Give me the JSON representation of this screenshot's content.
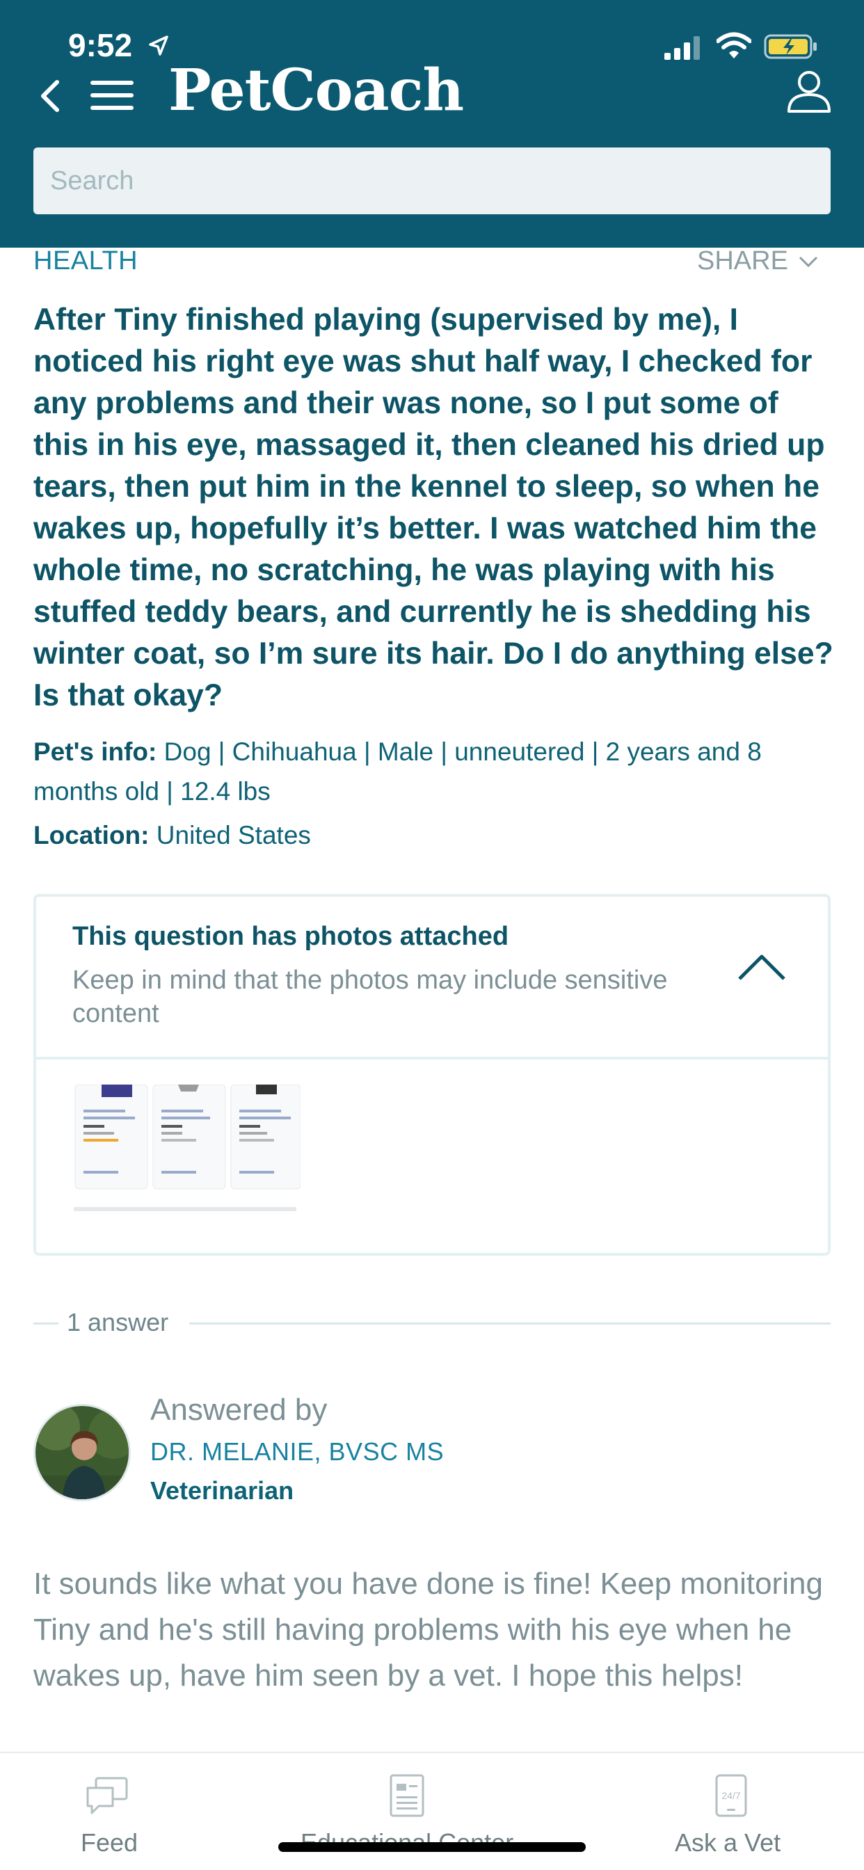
{
  "status_bar": {
    "time": "9:52"
  },
  "app": {
    "logo": "PetCoach",
    "search_placeholder": "Search"
  },
  "question": {
    "category": "HEALTH",
    "share_label": "SHARE",
    "text": "After Tiny finished playing (supervised by me), I noticed his right eye was shut half way, I checked for any problems and their was none, so I put some of this in his eye, massaged it, then cleaned his dried up tears, then put him in the kennel to sleep, so when he wakes up, hopefully it’s better. I was watched him the whole time, no scratching, he was playing with his stuffed teddy bears, and currently he is shedding his winter coat, so I’m sure its hair. Do I do anything else? Is that okay?",
    "pet_info_label": "Pet's info:",
    "pet_info": "Dog | Chihuahua | Male | unneutered | 2 years and 8 months old | 12.4 lbs",
    "location_label": "Location:",
    "location": "United States"
  },
  "photos": {
    "title": "This question has photos attached",
    "subtitle": "Keep in mind that the photos may include sensitive content"
  },
  "answers": {
    "count_label": "1 answer"
  },
  "answer": {
    "answered_by_label": "Answered by",
    "vet_name": "DR. MELANIE, BVSC MS",
    "vet_role": "Veterinarian",
    "text": "It sounds like what you have done is fine! Keep monitoring Tiny and he's still having problems with his eye when he wakes up, have him seen by a vet. I hope this helps!"
  },
  "tabbar": {
    "tabs": [
      {
        "label": "Feed",
        "icon": "feed-chat-icon"
      },
      {
        "label": "Educational Center",
        "icon": "article-icon"
      },
      {
        "label": "Ask a Vet",
        "icon": "phone-24-7-icon"
      }
    ]
  },
  "colors": {
    "header_bg": "#0b5a72",
    "accent": "#1882a1",
    "text_dark": "#0c5466",
    "text_muted": "#7b8f95",
    "battery_fill": "#f3d649"
  }
}
